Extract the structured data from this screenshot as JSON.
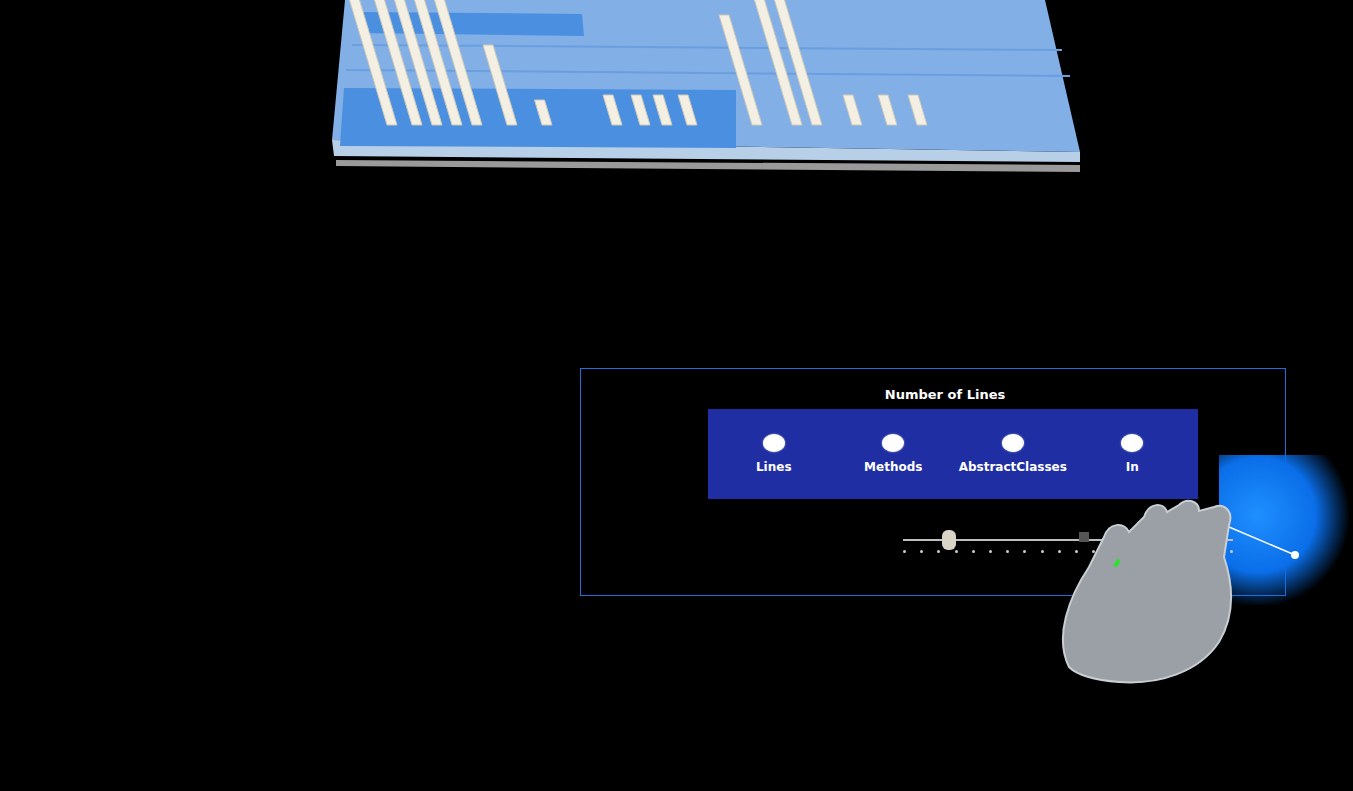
{
  "panel": {
    "title": "Number of Lines"
  },
  "options": [
    {
      "label": "Lines",
      "selected": false
    },
    {
      "label": "Methods",
      "selected": false
    },
    {
      "label": "AbstractClasses",
      "selected": false
    },
    {
      "label": "In",
      "selected": false
    }
  ],
  "slider": {
    "level": 0.14,
    "steps": 20
  },
  "city": {
    "buildings": [
      150,
      140,
      150,
      150,
      130,
      80,
      25,
      30,
      30,
      30,
      30,
      110,
      150,
      150,
      30,
      30,
      30
    ]
  }
}
